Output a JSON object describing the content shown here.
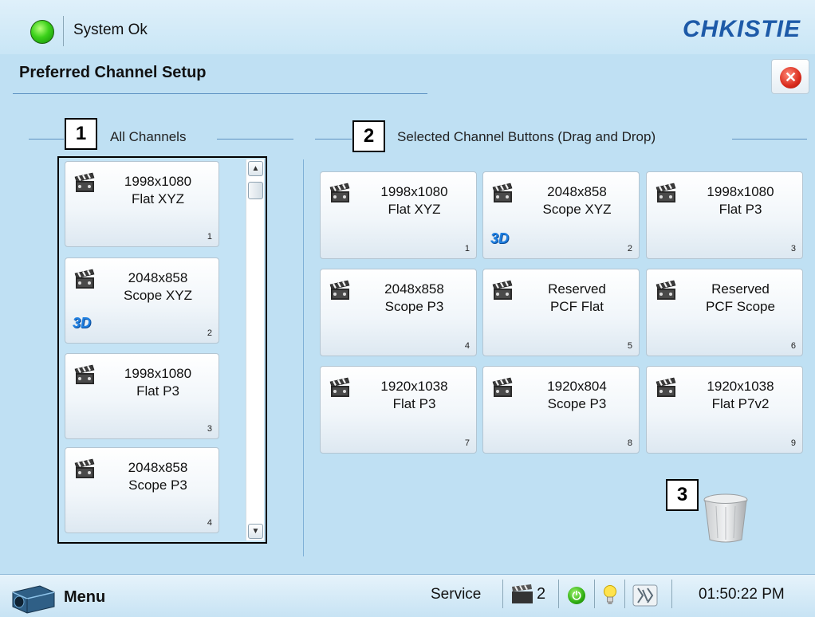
{
  "status": {
    "text": "System Ok",
    "led_color": "#3bd11a"
  },
  "brand": {
    "logo_text": "CHKISTIE"
  },
  "page": {
    "title": "Preferred Channel Setup"
  },
  "sections": {
    "all_channels": {
      "number": "1",
      "label": "All Channels"
    },
    "selected": {
      "number": "2",
      "label": "Selected Channel Buttons (Drag and Drop)"
    },
    "trash": {
      "number": "3"
    }
  },
  "all_channels": [
    {
      "line1": "1998x1080",
      "line2": "Flat XYZ",
      "num": "1",
      "is3d": false
    },
    {
      "line1": "2048x858",
      "line2": "Scope XYZ",
      "num": "2",
      "is3d": true
    },
    {
      "line1": "1998x1080",
      "line2": "Flat P3",
      "num": "3",
      "is3d": false
    },
    {
      "line1": "2048x858",
      "line2": "Scope P3",
      "num": "4",
      "is3d": false
    }
  ],
  "selected_buttons": [
    {
      "line1": "1998x1080",
      "line2": "Flat XYZ",
      "num": "1",
      "is3d": false
    },
    {
      "line1": "2048x858",
      "line2": "Scope XYZ",
      "num": "2",
      "is3d": true
    },
    {
      "line1": "1998x1080",
      "line2": "Flat P3",
      "num": "3",
      "is3d": false
    },
    {
      "line1": "2048x858",
      "line2": "Scope P3",
      "num": "4",
      "is3d": false
    },
    {
      "line1": "Reserved",
      "line2": "PCF Flat",
      "num": "5",
      "is3d": false
    },
    {
      "line1": "Reserved",
      "line2": "PCF Scope",
      "num": "6",
      "is3d": false
    },
    {
      "line1": "1920x1038",
      "line2": "Flat P3",
      "num": "7",
      "is3d": false
    },
    {
      "line1": "1920x804",
      "line2": "Scope P3",
      "num": "8",
      "is3d": false
    },
    {
      "line1": "1920x1038",
      "line2": "Flat P7v2",
      "num": "9",
      "is3d": false
    }
  ],
  "badge_3d": "3D",
  "bottom_bar": {
    "menu_label": "Menu",
    "service_label": "Service",
    "channel_count": "2",
    "clock": "01:50:22 PM"
  },
  "icons": {
    "status": "status-led-icon",
    "close": "close-icon",
    "tile": "film-clapper-icon",
    "trash": "trash-icon",
    "menu": "projector-icon",
    "channel": "clapper-icon",
    "power": "power-icon",
    "lamp": "lightbulb-icon",
    "interlock": "interlock-icon"
  }
}
